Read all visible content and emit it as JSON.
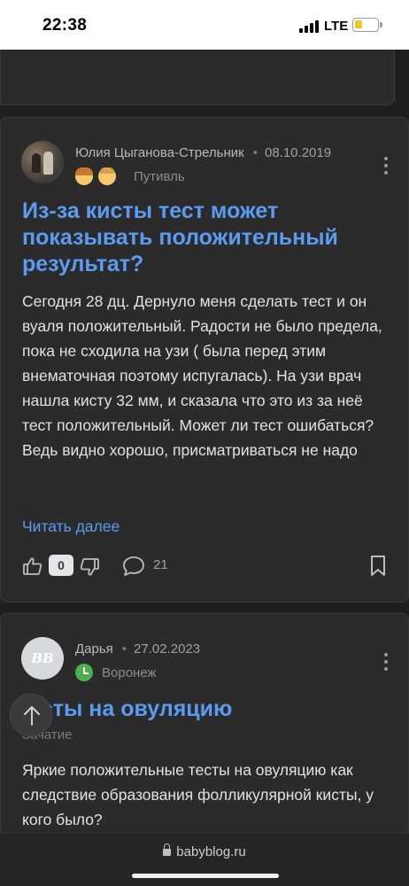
{
  "status_bar": {
    "time": "22:38",
    "network": "LTE"
  },
  "posts": [
    {
      "author": "Юлия Цыганова-Стрельник",
      "date": "08.10.2019",
      "city": "Путивль",
      "title": "Из-за кисты тест может показывать положительный результат?",
      "body": "Сегодня 28 дц. Дернуло меня сделать тест и он вуаля положительный. Радости не было предела, пока не сходила на узи ( была перед этим внематочная поэтому испугалась). На узи врач нашла кисту 32 мм, и сказала что это из за неё тест положительный. Может ли тест ошибаться? Ведь видно хорошо, присматриваться не надо",
      "read_more": "Читать далее",
      "likes": "0",
      "comments": "21"
    },
    {
      "author": "Дарья",
      "date": "27.02.2023",
      "city": "Воронеж",
      "avatar_text": "BB",
      "title": "...сты на овуляцию",
      "category": "Зачатие",
      "body": "Яркие положительные тесты на овуляцию как следствие образования фолликулярной кисты, у кого было?"
    }
  ],
  "browser": {
    "url": "babyblog.ru"
  },
  "colors": {
    "link": "#5b9bf0",
    "background": "#1f1f1f",
    "card": "#2b2b2b"
  }
}
